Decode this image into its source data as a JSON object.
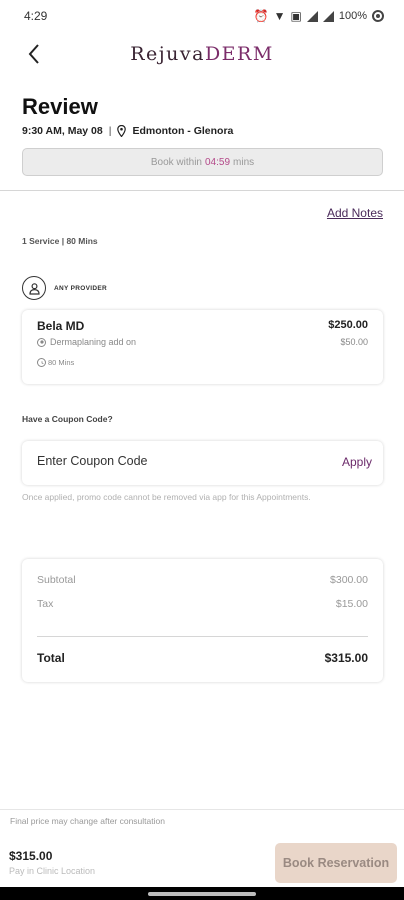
{
  "status_bar": {
    "time": "4:29",
    "battery_percent": "100%",
    "icons": [
      "alarm-icon",
      "wifi-icon",
      "lte-icon",
      "signal-icon",
      "signal-icon",
      "battery-icon"
    ]
  },
  "header": {
    "logo_part1": "RejuvaDerm",
    "logo_part1_display": "Rejuva",
    "logo_part2": "DERM"
  },
  "review": {
    "title": "Review",
    "datetime": "9:30 AM, May 08",
    "separator": "|",
    "location": "Edmonton - Glenora",
    "book_within_label": "Book within",
    "book_within_timer": "04:59",
    "book_within_unit": "mins"
  },
  "notes": {
    "add_notes_label": "Add Notes"
  },
  "service_summary": "1 Service | 80 Mins",
  "provider": {
    "label": "ANY PROVIDER"
  },
  "service": {
    "name": "Bela MD",
    "price": "$250.00",
    "addon_name": "Dermaplaning add on",
    "addon_price": "$50.00",
    "duration": "80 Mins"
  },
  "coupon": {
    "heading": "Have a Coupon Code?",
    "placeholder": "Enter Coupon Code",
    "apply_label": "Apply",
    "note": "Once applied, promo code cannot be removed via app for this Appointments."
  },
  "summary": {
    "subtotal_label": "Subtotal",
    "subtotal_value": "$300.00",
    "tax_label": "Tax",
    "tax_value": "$15.00",
    "total_label": "Total",
    "total_value": "$315.00"
  },
  "footer": {
    "price_note": "Final price may change after consultation",
    "price": "$315.00",
    "sub_label": "Pay in Clinic Location",
    "book_button": "Book Reservation"
  },
  "colors": {
    "brand_purple": "#7b2d6a",
    "timer_pink": "#b44a8a",
    "book_button_bg": "#e9d6c9"
  }
}
